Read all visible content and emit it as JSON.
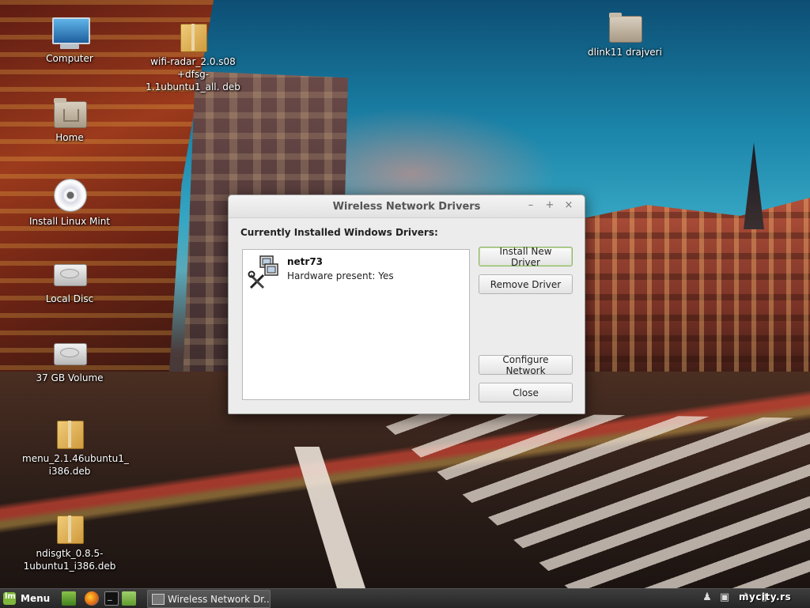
{
  "desktop": {
    "icons": [
      {
        "label": "Computer",
        "icon": "monitor-icon"
      },
      {
        "label": "Home",
        "icon": "home-folder-icon"
      },
      {
        "label": "Install Linux Mint",
        "icon": "disc-icon"
      },
      {
        "label": "Local Disc",
        "icon": "drive-icon"
      },
      {
        "label": "37 GB Volume",
        "icon": "drive-icon"
      },
      {
        "label": "menu_2.1.46ubuntu1_ i386.deb",
        "icon": "package-icon"
      },
      {
        "label": "ndisgtk_0.8.5- 1ubuntu1_i386.deb",
        "icon": "package-icon"
      },
      {
        "label": "wifi-radar_2.0.s08 +dfsg-1.1ubuntu1_all. deb",
        "icon": "package-icon"
      },
      {
        "label": "dlink11 drajveri",
        "icon": "folder-icon"
      }
    ]
  },
  "dialog": {
    "title": "Wireless Network Drivers",
    "window_buttons": {
      "minimize": "–",
      "maximize": "+",
      "close": "×"
    },
    "heading": "Currently Installed Windows Drivers:",
    "drivers": [
      {
        "name": "netr73",
        "status": "Hardware present: Yes",
        "icon": "network-driver-icon"
      }
    ],
    "buttons": {
      "install": "Install New Driver",
      "remove": "Remove Driver",
      "configure": "Configure Network",
      "close": "Close"
    }
  },
  "taskbar": {
    "menu_label": "Menu",
    "launchers": [
      "show-desktop-icon",
      "firefox-icon",
      "terminal-icon",
      "files-icon"
    ],
    "active_window": "Wireless Network Dr...",
    "watermark": "mycity.rs"
  },
  "colors": {
    "accent": "#7fb83c",
    "panel": "#2f2f2f",
    "dialog_bg": "#ececec"
  }
}
